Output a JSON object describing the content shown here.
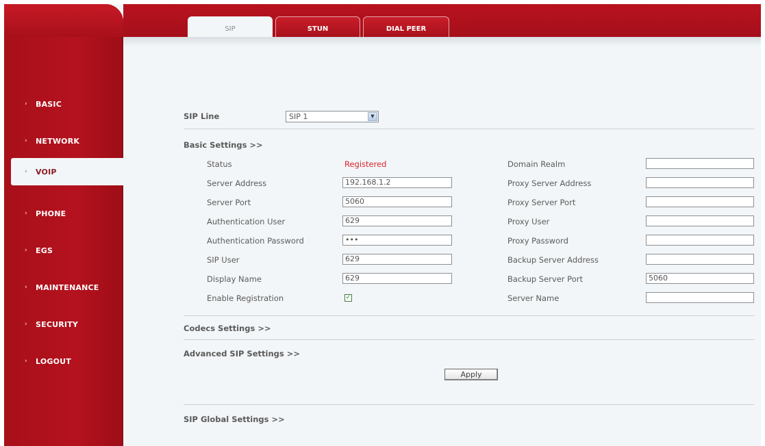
{
  "tabs": [
    {
      "label": "SIP",
      "active": true
    },
    {
      "label": "STUN",
      "active": false
    },
    {
      "label": "DIAL PEER",
      "active": false
    }
  ],
  "sidebar": {
    "items": [
      {
        "label": "BASIC"
      },
      {
        "label": "NETWORK"
      },
      {
        "label": "VOIP",
        "active": true
      },
      {
        "label": "PHONE"
      },
      {
        "label": "EGS"
      },
      {
        "label": "MAINTENANCE"
      },
      {
        "label": "SECURITY"
      },
      {
        "label": "LOGOUT"
      }
    ]
  },
  "sip_line": {
    "label": "SIP Line",
    "value": "SIP 1"
  },
  "sections": {
    "basic": "Basic Settings >>",
    "codecs": "Codecs Settings >>",
    "advanced": "Advanced SIP Settings >>",
    "global": "SIP Global Settings >>"
  },
  "left_fields": {
    "status": {
      "label": "Status",
      "value": "Registered"
    },
    "server_address": {
      "label": "Server Address",
      "value": "192.168.1.2"
    },
    "server_port": {
      "label": "Server Port",
      "value": "5060"
    },
    "auth_user": {
      "label": "Authentication User",
      "value": "629"
    },
    "auth_password": {
      "label": "Authentication Password",
      "value": "•••"
    },
    "sip_user": {
      "label": "SIP User",
      "value": "629"
    },
    "display_name": {
      "label": "Display Name",
      "value": "629"
    },
    "enable_registration": {
      "label": "Enable Registration",
      "checked": true
    }
  },
  "right_fields": {
    "domain_realm": {
      "label": "Domain Realm",
      "value": ""
    },
    "proxy_server_address": {
      "label": "Proxy Server Address",
      "value": ""
    },
    "proxy_server_port": {
      "label": "Proxy Server Port",
      "value": ""
    },
    "proxy_user": {
      "label": "Proxy User",
      "value": ""
    },
    "proxy_password": {
      "label": "Proxy Password",
      "value": ""
    },
    "backup_server_address": {
      "label": "Backup Server Address",
      "value": ""
    },
    "backup_server_port": {
      "label": "Backup Server Port",
      "value": "5060"
    },
    "server_name": {
      "label": "Server Name",
      "value": ""
    }
  },
  "apply_label": "Apply",
  "colors": {
    "brand_red": "#b0111c",
    "status_registered": "#d9232d",
    "content_bg": "#f3f6f8"
  }
}
